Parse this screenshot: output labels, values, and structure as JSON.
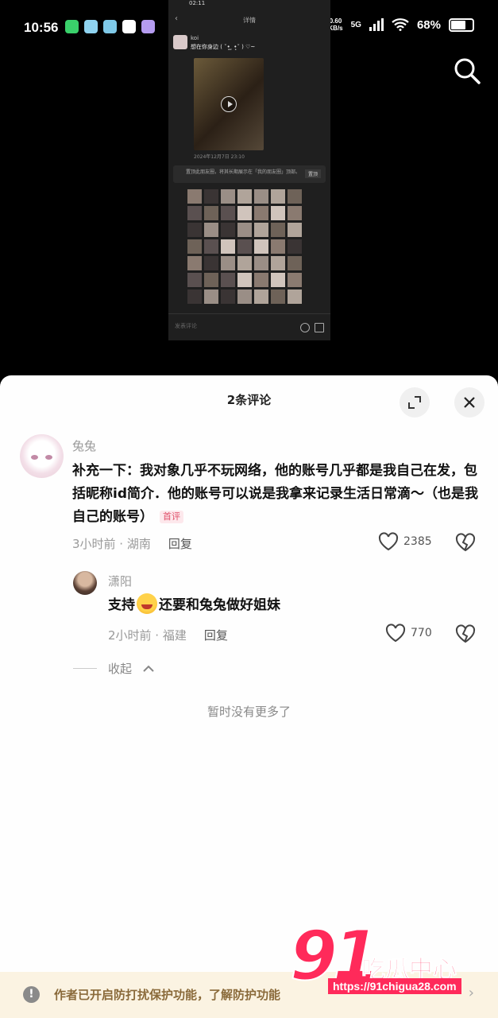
{
  "status_bar": {
    "time": "10:56",
    "net_speed_value": "0.60",
    "net_speed_unit": "KB/s",
    "network": "5G",
    "battery": "68%",
    "battery_level": 0.68,
    "app_icon_colors": [
      "#3ad16b",
      "#8fd3f0",
      "#7fc9e8",
      "#ffffff",
      "#b59cf0"
    ]
  },
  "embedded_screenshot": {
    "time": "02:11",
    "title": "详情",
    "user": "koi",
    "message": "想在你身边 ( ˘•̥ ̫ •̥˘ ) ♡~",
    "date": "2024年12月7日 23:10",
    "notice": "置顶此朋友圈，将其长期展示在「我的朋友圈」顶部。",
    "pin_label": "置顶",
    "input_placeholder": "发表评论"
  },
  "sheet": {
    "title": "2条评论"
  },
  "comments": [
    {
      "author": "兔兔",
      "text": "补充一下：我对象几乎不玩网络，他的账号几乎都是我自己在发，包括昵称id简介．他的账号可以说是我拿来记录生活日常滴～（也是我自己的账号）",
      "badge": "首评",
      "time_location": "3小时前 · 湖南",
      "reply_label": "回复",
      "likes": "2385"
    },
    {
      "author": "潇阳",
      "text_before": "支持",
      "text_after": "还要和兔兔做好姐妹",
      "time_location": "2小时前 · 福建",
      "reply_label": "回复",
      "likes": "770"
    }
  ],
  "collapse_label": "收起",
  "no_more_text": "暂时没有更多了",
  "banner": {
    "text": "作者已开启防打扰保护功能，了解防护功能",
    "icon": "!"
  },
  "watermark": {
    "number": "91",
    "name": "吃瓜中心",
    "url": "https://91chigua28.com"
  },
  "colors": {
    "accent": "#ff2a5a",
    "badge": "#e0506a",
    "banner_bg": "#fbf3e2"
  }
}
